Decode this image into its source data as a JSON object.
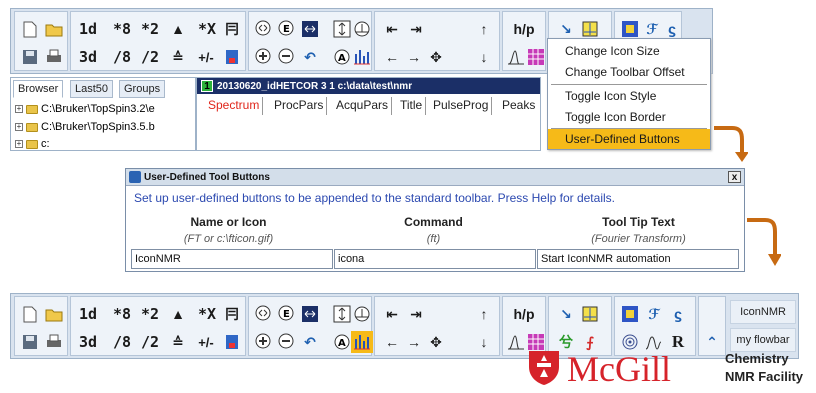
{
  "toolbar": {
    "row1_text": [
      "1d",
      "*8",
      "*2"
    ],
    "row2_text": [
      "3d",
      "/8",
      "/2"
    ],
    "cross_label": "*X",
    "plus_minus": "+/-",
    "hp_label": "h/p"
  },
  "browser": {
    "tabs": [
      "Browser",
      "Last50",
      "Groups"
    ],
    "tree": [
      "C:\\Bruker\\TopSpin3.2\\e",
      "C:\\Bruker\\TopSpin3.5.b",
      "c:"
    ]
  },
  "data_window": {
    "number": "1",
    "title": "20130620_idHETCOR  3  1  c:\\data\\test\\nmr",
    "tabs": [
      "Spectrum",
      "ProcPars",
      "AcquPars",
      "Title",
      "PulseProg",
      "Peaks"
    ]
  },
  "menu": {
    "items": [
      "Change Icon Size",
      "Change Toolbar Offset",
      "Toggle Icon Style",
      "Toggle Icon Border",
      "User-Defined Buttons"
    ],
    "selected": "User-Defined Buttons"
  },
  "dialog": {
    "title": "User-Defined Tool Buttons",
    "close": "x",
    "instruction": "Set up user-defined buttons to be appended to the standard toolbar. Press Help for details.",
    "columns": [
      {
        "header": "Name or Icon",
        "hint": "(FT or c:\\fticon.gif)",
        "value": "IconNMR"
      },
      {
        "header": "Command",
        "hint": "(ft)",
        "value": "icona"
      },
      {
        "header": "Tool Tip Text",
        "hint": "(Fourier Transform)",
        "value": "Start IconNMR automation"
      }
    ]
  },
  "user_buttons": [
    "IconNMR",
    "my flowbar"
  ],
  "logo": {
    "word": "McGill",
    "line1": "Chemistry",
    "line2": "NMR Facility"
  },
  "colors": {
    "accent": "#f6ba18",
    "arrow": "#c76a12",
    "title_bar": "#1b2f67",
    "brand_red": "#d6232a"
  }
}
